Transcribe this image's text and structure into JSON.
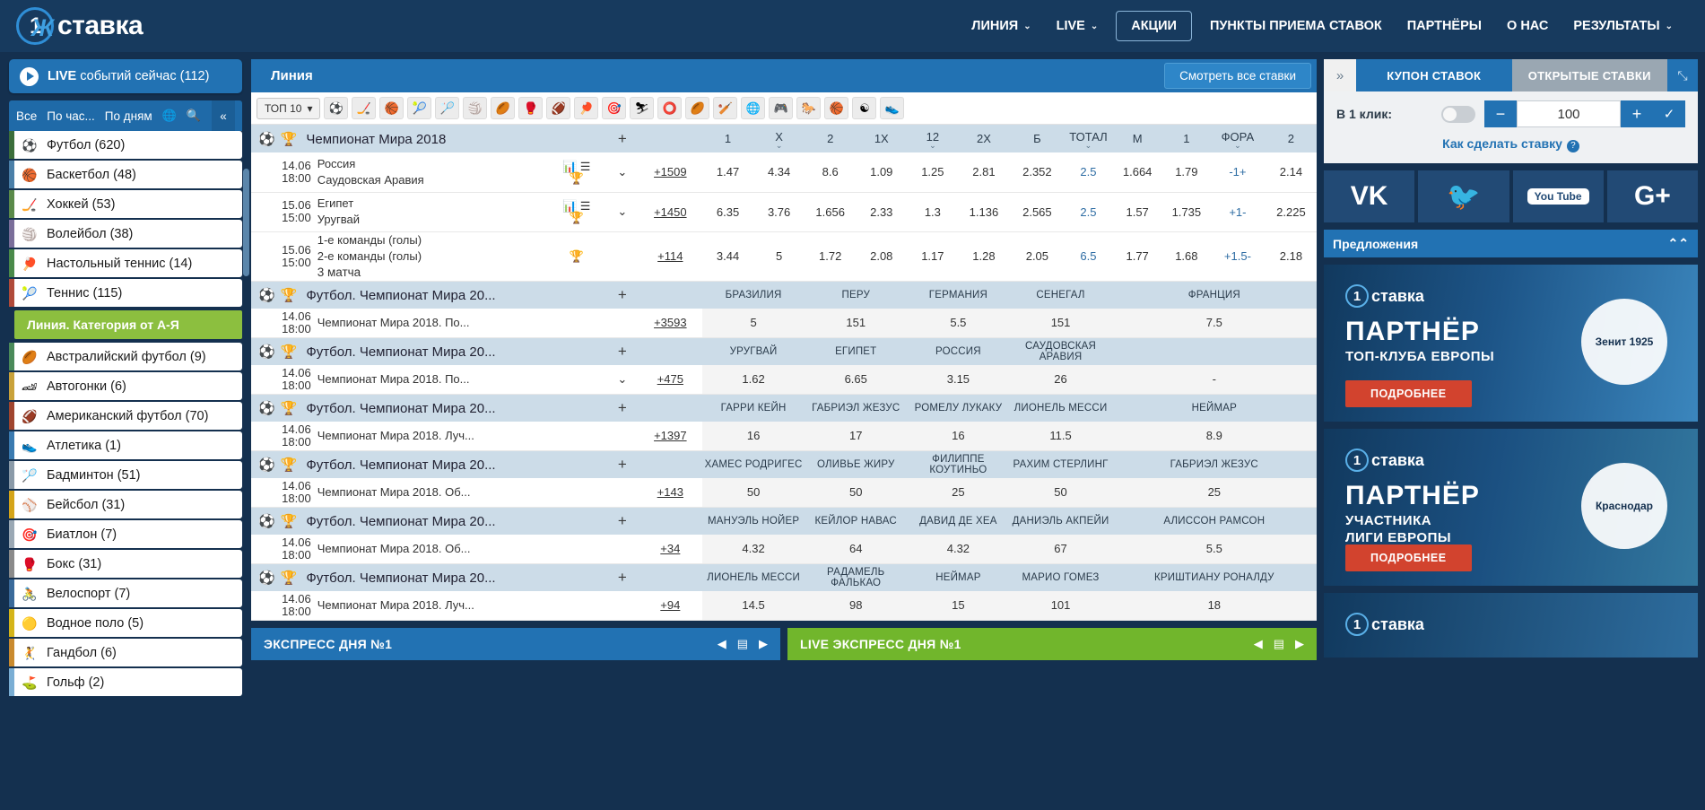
{
  "header": {
    "logo_text": "ставка",
    "logo_one": "1",
    "nav": [
      {
        "label": "ЛИНИЯ",
        "caret": true,
        "boxed": false
      },
      {
        "label": "LIVE",
        "caret": true,
        "boxed": false
      },
      {
        "label": "АКЦИИ",
        "caret": false,
        "boxed": true
      },
      {
        "label": "ПУНКТЫ ПРИЕМА СТАВОК",
        "caret": false,
        "boxed": false
      },
      {
        "label": "ПАРТНЁРЫ",
        "caret": false,
        "boxed": false
      },
      {
        "label": "О НАС",
        "caret": false,
        "boxed": false
      },
      {
        "label": "РЕЗУЛЬТАТЫ",
        "caret": true,
        "boxed": false
      }
    ]
  },
  "sidebar": {
    "live_button": "LIVE событий сейчас (112)",
    "live_bold": "LIVE",
    "live_rest": " событий сейчас (112)",
    "filters": [
      "Все",
      "По час...",
      "По дням"
    ],
    "globe_icon": "globe-icon",
    "search_icon": "search-icon",
    "collapse_icon": "collapse-icon",
    "top_sports": [
      {
        "label": "Футбол (620)",
        "icon": "⚽",
        "bar": "#3b6e3b"
      },
      {
        "label": "Баскетбол (48)",
        "icon": "🏀",
        "bar": "#4a7fa8"
      },
      {
        "label": "Хоккей (53)",
        "icon": "🏒",
        "bar": "#5a8a4a"
      },
      {
        "label": "Волейбол (38)",
        "icon": "🏐",
        "bar": "#7a6e9a"
      },
      {
        "label": "Настольный теннис (14)",
        "icon": "🏓",
        "bar": "#4a8a4a"
      },
      {
        "label": "Теннис (115)",
        "icon": "🎾",
        "bar": "#b04a3a"
      }
    ],
    "category_divider": "Линия. Категория от А-Я",
    "sports": [
      {
        "label": "Австралийский футбол (9)",
        "icon": "🏉",
        "bar": "#4a8a5a"
      },
      {
        "label": "Автогонки (6)",
        "icon": "🏎",
        "bar": "#c9a23a"
      },
      {
        "label": "Американский футбол (70)",
        "icon": "🏈",
        "bar": "#a0452e"
      },
      {
        "label": "Атлетика (1)",
        "icon": "👟",
        "bar": "#3a7ab0"
      },
      {
        "label": "Бадминтон (51)",
        "icon": "🏸",
        "bar": "#8a9aa8"
      },
      {
        "label": "Бейсбол (31)",
        "icon": "⚾",
        "bar": "#d4a419"
      },
      {
        "label": "Биатлон (7)",
        "icon": "🎯",
        "bar": "#9aa8b4"
      },
      {
        "label": "Бокс (31)",
        "icon": "🥊",
        "bar": "#8a8a8a"
      },
      {
        "label": "Велоспорт (7)",
        "icon": "🚴",
        "bar": "#3a6a9a"
      },
      {
        "label": "Водное поло (5)",
        "icon": "🟡",
        "bar": "#d4b419"
      },
      {
        "label": "Гандбол (6)",
        "icon": "🤾",
        "bar": "#c98a2e"
      },
      {
        "label": "Гольф (2)",
        "icon": "⛳",
        "bar": "#7aaed4"
      }
    ]
  },
  "main": {
    "line_title": "Линия",
    "all_bets_button": "Смотреть все ставки",
    "top10_label": "ТОП 10",
    "sport_chips": [
      "⚽",
      "🏒",
      "🏀",
      "🎾",
      "🏸",
      "🏐",
      "🏉",
      "🥊",
      "🏈",
      "🏓",
      "🎯",
      "⛷",
      "⭕",
      "🏉",
      "🏏",
      "🌐",
      "🎮",
      "🐎",
      "🏀",
      "☯",
      "👟"
    ],
    "columns": [
      "+",
      "1",
      "X",
      "2",
      "1X",
      "12",
      "2X",
      "Б",
      "ТОТАЛ",
      "М",
      "1",
      "ФОРА",
      "2"
    ],
    "league1": {
      "name": "Чемпионат Мира 2018",
      "plus": "+"
    },
    "matches": [
      {
        "date": "14.06",
        "time": "18:00",
        "team1": "Россия",
        "team2": "Саудовская Аравия",
        "team3": "",
        "more": "+1509",
        "odds": [
          "1.47",
          "4.34",
          "8.6",
          "1.09",
          "1.25",
          "2.81",
          "2.352",
          "2.5",
          "1.664",
          "1.79",
          "-1+",
          "2.14"
        ],
        "has_chart_icons": true,
        "has_chevron": true
      },
      {
        "date": "15.06",
        "time": "15:00",
        "team1": "Египет",
        "team2": "Уругвай",
        "team3": "",
        "more": "+1450",
        "odds": [
          "6.35",
          "3.76",
          "1.656",
          "2.33",
          "1.3",
          "1.136",
          "2.565",
          "2.5",
          "1.57",
          "1.735",
          "+1-",
          "2.225"
        ],
        "has_chart_icons": true,
        "has_chevron": true
      },
      {
        "date": "15.06",
        "time": "15:00",
        "team1": "1-е команды (голы)",
        "team2": "2-е команды (голы)",
        "team3": "3 матча",
        "more": "+114",
        "odds": [
          "3.44",
          "5",
          "1.72",
          "2.08",
          "1.17",
          "1.28",
          "2.05",
          "6.5",
          "1.77",
          "1.68",
          "+1.5-",
          "2.18"
        ],
        "has_chart_icons": false,
        "has_chevron": false
      }
    ],
    "outright_groups": [
      {
        "league": "Футбол. Чемпионат Мира 20...",
        "plus": "+",
        "headers": [
          "БРАЗИЛИЯ",
          "ПЕРУ",
          "ГЕРМАНИЯ",
          "СЕНЕГАЛ",
          "ФРАНЦИЯ"
        ],
        "row_date": "14.06",
        "row_time": "18:00",
        "row_name": "Чемпионат Мира 2018. По...",
        "more": "+3593",
        "values": [
          "5",
          "151",
          "5.5",
          "151",
          "7.5"
        ]
      },
      {
        "league": "Футбол. Чемпионат Мира 20...",
        "plus": "+",
        "headers": [
          "УРУГВАЙ",
          "ЕГИПЕТ",
          "РОССИЯ",
          "САУДОВСКАЯ АРАВИЯ",
          ""
        ],
        "row_date": "14.06",
        "row_time": "18:00",
        "row_name": "Чемпионат Мира 2018. По...",
        "more": "+475",
        "values": [
          "1.62",
          "6.65",
          "3.15",
          "26",
          "-"
        ],
        "has_chevron": true
      },
      {
        "league": "Футбол. Чемпионат Мира 20...",
        "plus": "+",
        "headers": [
          "ГАРРИ КЕЙН",
          "ГАБРИЭЛ ЖЕЗУС",
          "РОМЕЛУ ЛУКАКУ",
          "ЛИОНЕЛЬ МЕССИ",
          "НЕЙМАР"
        ],
        "row_date": "14.06",
        "row_time": "18:00",
        "row_name": "Чемпионат Мира 2018. Луч...",
        "more": "+1397",
        "values": [
          "16",
          "17",
          "16",
          "11.5",
          "8.9"
        ]
      },
      {
        "league": "Футбол. Чемпионат Мира 20...",
        "plus": "+",
        "headers": [
          "ХАМЕС РОДРИГЕС",
          "ОЛИВЬЕ ЖИРУ",
          "ФИЛИППЕ КОУТИНЬО",
          "РАХИМ СТЕРЛИНГ",
          "ГАБРИЭЛ ЖЕЗУС"
        ],
        "row_date": "14.06",
        "row_time": "18:00",
        "row_name": "Чемпионат Мира 2018. Об...",
        "more": "+143",
        "values": [
          "50",
          "50",
          "25",
          "50",
          "25"
        ]
      },
      {
        "league": "Футбол. Чемпионат Мира 20...",
        "plus": "+",
        "headers": [
          "МАНУЭЛЬ НОЙЕР",
          "КЕЙЛОР НАВАС",
          "ДАВИД ДЕ ХЕА",
          "ДАНИЭЛЬ АКПЕЙИ",
          "АЛИССОН РАМСОН"
        ],
        "row_date": "14.06",
        "row_time": "18:00",
        "row_name": "Чемпионат Мира 2018. Об...",
        "more": "+34",
        "values": [
          "4.32",
          "64",
          "4.32",
          "67",
          "5.5"
        ]
      },
      {
        "league": "Футбол. Чемпионат Мира 20...",
        "plus": "+",
        "headers": [
          "ЛИОНЕЛЬ МЕССИ",
          "РАДАМЕЛЬ ФАЛЬКАО",
          "НЕЙМАР",
          "МАРИО ГОМЕЗ",
          "КРИШТИАНУ РОНАЛДУ"
        ],
        "row_date": "14.06",
        "row_time": "18:00",
        "row_name": "Чемпионат Мира 2018. Луч...",
        "more": "+94",
        "values": [
          "14.5",
          "98",
          "15",
          "101",
          "18"
        ]
      }
    ]
  },
  "coupon": {
    "tab_active": "КУПОН СТАВОК",
    "tab_inactive": "ОТКРЫТЫЕ СТАВКИ",
    "expand_icon": "chevron-right-icon",
    "pin_icon": "pin-icon",
    "oneclick_label": "В 1 клик:",
    "minus": "−",
    "plus": "+",
    "amount": "100",
    "check": "✓",
    "howto": "Как сделать ставку",
    "help_icon": "?"
  },
  "socials": [
    {
      "name": "vk-icon",
      "glyph": "VK"
    },
    {
      "name": "twitter-icon",
      "glyph": "🐦"
    },
    {
      "name": "youtube-icon",
      "glyph": "You Tube"
    },
    {
      "name": "google-plus-icon",
      "glyph": "G+"
    }
  ],
  "offers": {
    "title": "Предложения",
    "banners": [
      {
        "logo": "1Хставка",
        "line1": "ПАРТНЁР",
        "line2": "ТОП-КЛУБА ЕВРОПЫ",
        "line3": "",
        "button": "ПОДРОБНЕЕ",
        "emblem": "Зенит 1925"
      },
      {
        "logo": "1Хставка",
        "line1": "ПАРТНЁР",
        "line2": "УЧАСТНИКА",
        "line3": "ЛИГИ ЕВРОПЫ",
        "button": "ПОДРОБНЕЕ",
        "emblem": "Краснодар"
      },
      {
        "logo": "1Хставка",
        "line1": "",
        "line2": "",
        "line3": "",
        "button": "",
        "emblem": ""
      }
    ]
  },
  "bottom": {
    "express_label": "ЭКСПРЕСС ДНЯ №1",
    "live_express_label": "LIVE ЭКСПРЕСС ДНЯ №1",
    "prev_icon": "◀",
    "list_icon": "▤",
    "next_icon": "▶"
  }
}
